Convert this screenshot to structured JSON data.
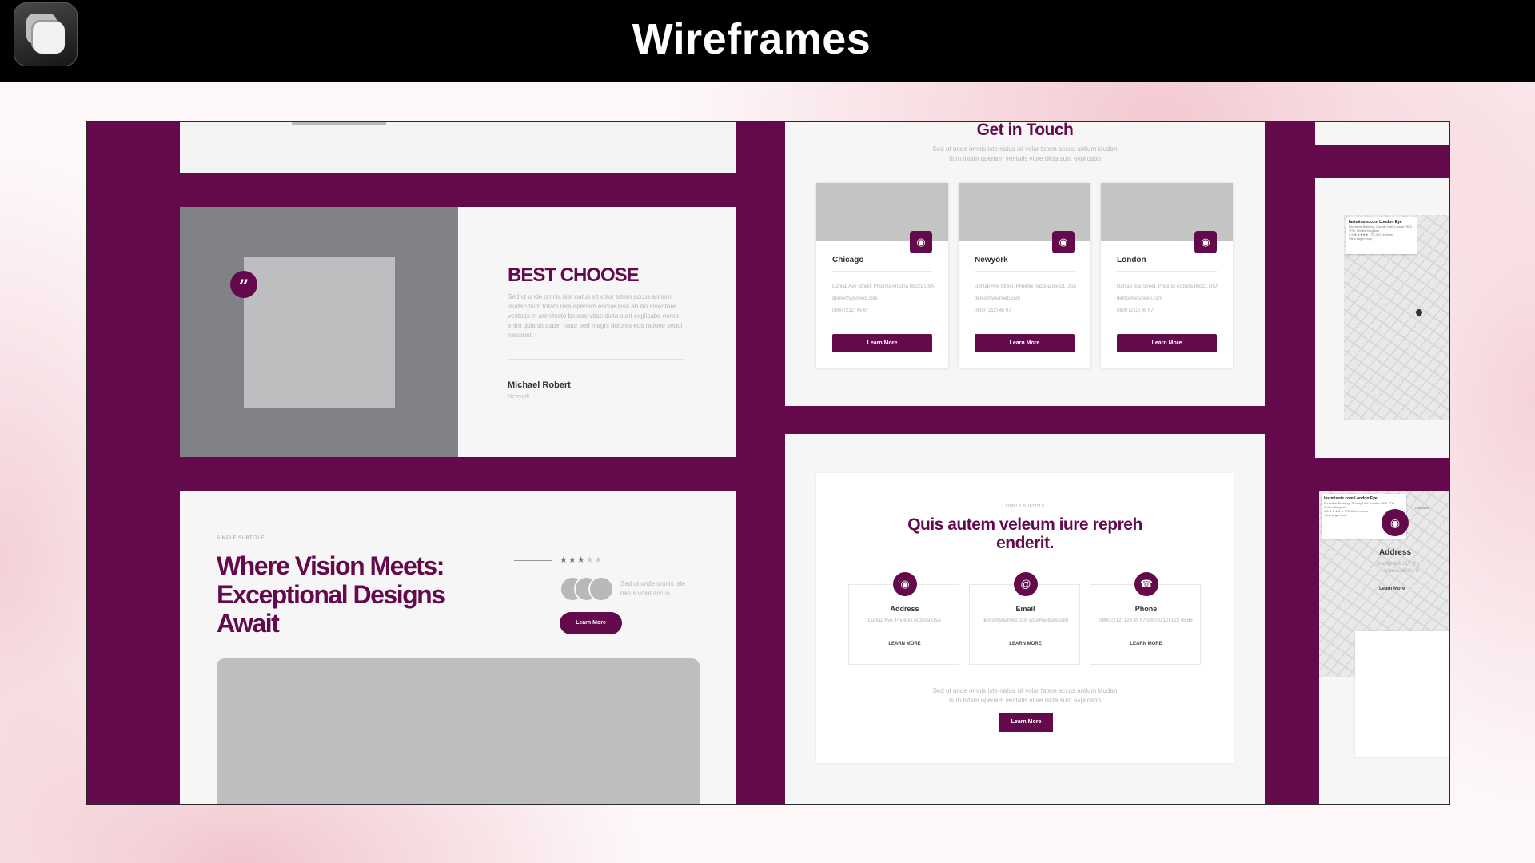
{
  "app": {
    "title": "Wireframes",
    "icon": "stacked-squares-icon"
  },
  "colors": {
    "brand": "#640a4c",
    "topbar": "#000000"
  },
  "testimonial": {
    "heading": "BEST CHOOSE",
    "body": "Sed ut unde omnis iste natus sit volur tatem accus antium laudan tium totam rem aperiam eaque ipsa ab illo inventore veritatis et architecto beatae vitae dicta sunt explicabo nemo enim quia sit asper natur sed magni dolores eos ratione sequi nesciunt.",
    "author_name": "Michael Robert",
    "author_place": "Newyork",
    "quote_icon": "quote-icon"
  },
  "hero": {
    "subtitle": "SIMPLE SUBTITLE",
    "headline": "Where Vision Meets: Exceptional Designs Await",
    "rating_stars_filled": 3,
    "rating_stars_total": 5,
    "avatars_text": "Sed ut unde omnis iste natus volut accus",
    "cta_label": "Learn More"
  },
  "get_in_touch": {
    "title": "Get in Touch",
    "lead": "Sed ut unde omnis iste natus sit volur tatem accus antium laudan tium totam aperiam veritatis vitae dicta sunt explicabo",
    "cards": [
      {
        "city": "Chicago",
        "address": "Dunlap Ave Street, Phoenix Arizona 85021 USA",
        "email": "demo@yourweb.com",
        "phone": "0800 (212) 45 67",
        "button": "Learn More"
      },
      {
        "city": "Newyork",
        "address": "Dunlap Ave Street, Phoenix Arizona 85021 USA",
        "email": "demo@yourweb.com",
        "phone": "0800 (212) 45 67",
        "button": "Learn More"
      },
      {
        "city": "London",
        "address": "Dunlap Ave Street, Phoenix Arizona 85021 USA",
        "email": "demo@yourweb.com",
        "phone": "0800 (212) 45 67",
        "button": "Learn More"
      }
    ]
  },
  "contact": {
    "subtitle": "SIMPLE SUBTITLE",
    "headline": "Quis autem veleum iure repreh enderit.",
    "items": [
      {
        "title": "Address",
        "detail": "Dunlap Ave, Phoenix Arizona USA",
        "link": "LEARN MORE",
        "icon": "map-pin-icon"
      },
      {
        "title": "Email",
        "detail": "demo@yourweb.com you@website.com",
        "link": "LEARN MORE",
        "icon": "at-sign-icon"
      },
      {
        "title": "Phone",
        "detail": "0800 (212) 123 45 67 0800 (212) 123 45 68",
        "link": "LEARN MORE",
        "icon": "phone-icon"
      }
    ],
    "bottom_text": "Sed ut unde omnis iste natus sit volur tatem accus antium laudan tium totam aperiam veritatis vitae dicta sunt explicabo",
    "button": "Learn More"
  },
  "maps": {
    "top_card_title": "lastminute.com London Eye",
    "top_card_address": "Riverside Building, County Hall, London SE1 7PB, United Kingdom",
    "top_card_rating": "4.5 ★★★★★ 175,331 reviews",
    "top_card_link": "View larger map",
    "bottom_card_title": "lastminute.com London Eye",
    "bottom_card_address": "Riverside Building, County Hall, London SE1 7PB, United Kingdom",
    "bottom_card_rating": "4.5 ★★★★★ 175,331 reviews",
    "bottom_card_link": "View larger map",
    "directions": "Directions",
    "address_title": "Address",
    "address_detail": "Dunlap Ave 217, Ph Arizona 85021 U",
    "address_link": "Learn More"
  }
}
